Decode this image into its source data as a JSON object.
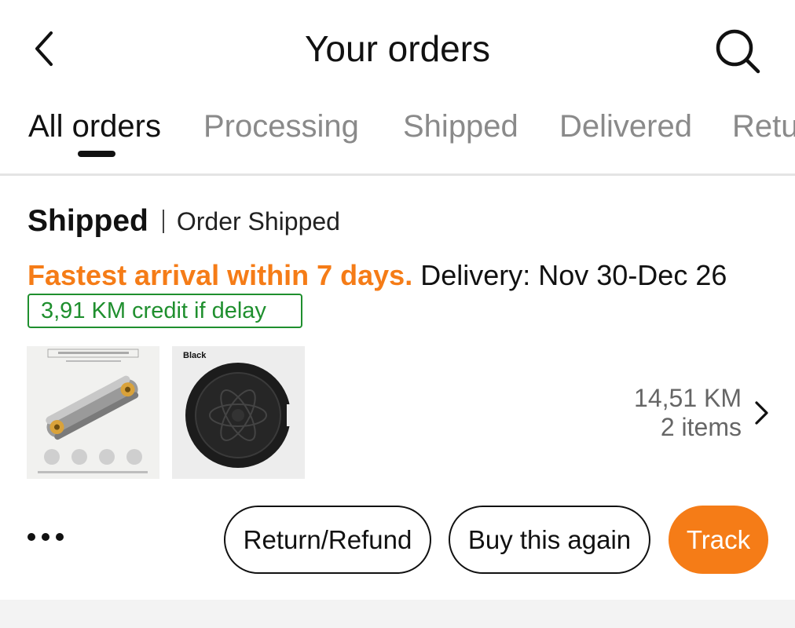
{
  "header": {
    "title": "Your orders",
    "back_icon": "chevron-left-icon",
    "search_icon": "search-icon"
  },
  "tabs": [
    {
      "label": "All orders",
      "active": true
    },
    {
      "label": "Processing",
      "active": false
    },
    {
      "label": "Shipped",
      "active": false
    },
    {
      "label": "Delivered",
      "active": false
    },
    {
      "label": "Retu",
      "active": false
    }
  ],
  "order": {
    "status": "Shipped",
    "status_detail": "Order Shipped",
    "delivery_fast": "Fastest arrival within 7 days.",
    "delivery_date": "Delivery: Nov 30-Dec 26",
    "credit_badge": "3,91 KM credit if delay",
    "items": [
      {
        "name": "item-1-thumbnail",
        "caption": ""
      },
      {
        "name": "item-2-thumbnail",
        "caption": "Black"
      }
    ],
    "total": "14,51 KM",
    "item_count": "2 items",
    "actions": {
      "more": "•••",
      "return": "Return/Refund",
      "buy_again": "Buy this again",
      "track": "Track"
    }
  },
  "colors": {
    "accent": "#f57c17",
    "credit_green": "#1f8f2e",
    "text": "#111111",
    "muted": "#8a8a8a",
    "divider": "#e4e4e4"
  }
}
